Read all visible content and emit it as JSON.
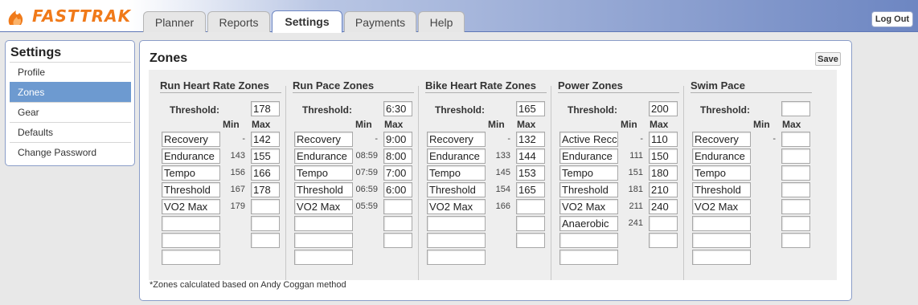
{
  "brand": {
    "name": "FASTTRAK",
    "accent": "#f07a1a"
  },
  "tabs": [
    {
      "label": "Planner",
      "active": false
    },
    {
      "label": "Reports",
      "active": false
    },
    {
      "label": "Settings",
      "active": true
    },
    {
      "label": "Payments",
      "active": false
    },
    {
      "label": "Help",
      "active": false
    }
  ],
  "logout_label": "Log Out",
  "sidebar": {
    "title": "Settings",
    "items": [
      {
        "label": "Profile",
        "active": false
      },
      {
        "label": "Zones",
        "active": true
      },
      {
        "label": "Gear",
        "active": false
      },
      {
        "label": "Defaults",
        "active": false
      },
      {
        "label": "Change Password",
        "active": false
      }
    ]
  },
  "main": {
    "title": "Zones",
    "save_label": "Save",
    "footnote": "*Zones calculated based on Andy Coggan method",
    "threshold_label": "Threshold:",
    "min_header": "Min",
    "max_header": "Max",
    "columns": [
      {
        "title": "Run Heart Rate Zones",
        "threshold": "178",
        "rows": [
          {
            "name": "Recovery",
            "min": "-",
            "max": "142"
          },
          {
            "name": "Endurance",
            "min": "143",
            "max": "155"
          },
          {
            "name": "Tempo",
            "min": "156",
            "max": "166"
          },
          {
            "name": "Threshold",
            "min": "167",
            "max": "178"
          },
          {
            "name": "VO2 Max",
            "min": "179",
            "max": ""
          },
          {
            "name": "",
            "min": "",
            "max": ""
          },
          {
            "name": "",
            "min": "",
            "max": ""
          },
          {
            "name": "",
            "min": "",
            "max": null
          }
        ]
      },
      {
        "title": "Run Pace Zones",
        "threshold": "6:30",
        "rows": [
          {
            "name": "Recovery",
            "min": "-",
            "max": "9:00"
          },
          {
            "name": "Endurance",
            "min": "08:59",
            "max": "8:00"
          },
          {
            "name": "Tempo",
            "min": "07:59",
            "max": "7:00"
          },
          {
            "name": "Threshold",
            "min": "06:59",
            "max": "6:00"
          },
          {
            "name": "VO2 Max",
            "min": "05:59",
            "max": ""
          },
          {
            "name": "",
            "min": "",
            "max": ""
          },
          {
            "name": "",
            "min": "",
            "max": ""
          },
          {
            "name": "",
            "min": "",
            "max": null
          }
        ]
      },
      {
        "title": "Bike Heart Rate Zones",
        "threshold": "165",
        "rows": [
          {
            "name": "Recovery",
            "min": "-",
            "max": "132"
          },
          {
            "name": "Endurance",
            "min": "133",
            "max": "144"
          },
          {
            "name": "Tempo",
            "min": "145",
            "max": "153"
          },
          {
            "name": "Threshold",
            "min": "154",
            "max": "165"
          },
          {
            "name": "VO2 Max",
            "min": "166",
            "max": ""
          },
          {
            "name": "",
            "min": "",
            "max": ""
          },
          {
            "name": "",
            "min": "",
            "max": ""
          },
          {
            "name": "",
            "min": "",
            "max": null
          }
        ]
      },
      {
        "title": "Power Zones",
        "threshold": "200",
        "rows": [
          {
            "name": "Active Recc",
            "min": "-",
            "max": "110"
          },
          {
            "name": "Endurance",
            "min": "111",
            "max": "150"
          },
          {
            "name": "Tempo",
            "min": "151",
            "max": "180"
          },
          {
            "name": "Threshold",
            "min": "181",
            "max": "210"
          },
          {
            "name": "VO2 Max",
            "min": "211",
            "max": "240"
          },
          {
            "name": "Anaerobic",
            "min": "241",
            "max": ""
          },
          {
            "name": "",
            "min": "",
            "max": ""
          },
          {
            "name": "",
            "min": "",
            "max": null
          }
        ]
      },
      {
        "title": "Swim Pace",
        "threshold": "",
        "rows": [
          {
            "name": "Recovery",
            "min": "-",
            "max": ""
          },
          {
            "name": "Endurance",
            "min": "",
            "max": ""
          },
          {
            "name": "Tempo",
            "min": "",
            "max": ""
          },
          {
            "name": "Threshold",
            "min": "",
            "max": ""
          },
          {
            "name": "VO2 Max",
            "min": "",
            "max": ""
          },
          {
            "name": "",
            "min": "",
            "max": ""
          },
          {
            "name": "",
            "min": "",
            "max": ""
          },
          {
            "name": "",
            "min": "",
            "max": null
          }
        ]
      }
    ]
  }
}
